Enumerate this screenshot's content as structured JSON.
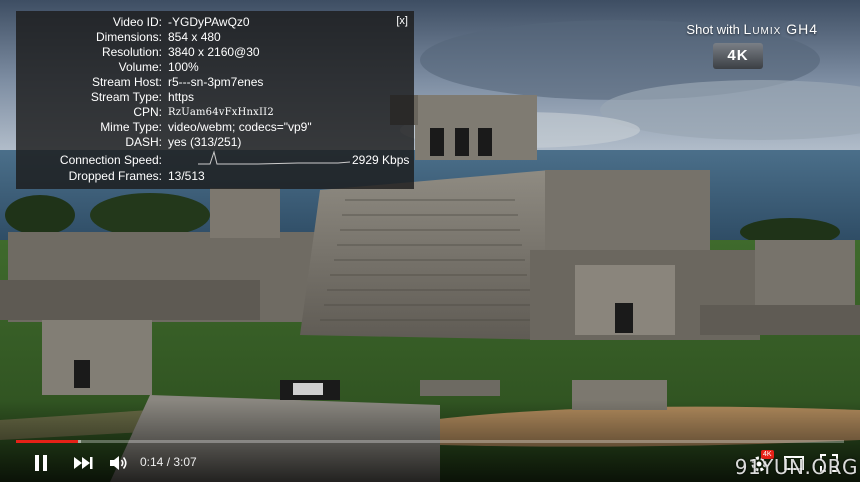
{
  "stats": {
    "close_label": "[x]",
    "rows": [
      {
        "key": "Video ID:",
        "value": "-YGDyPAwQz0"
      },
      {
        "key": "Dimensions:",
        "value": "854 x 480"
      },
      {
        "key": "Resolution:",
        "value": "3840 x 2160@30"
      },
      {
        "key": "Volume:",
        "value": "100%"
      },
      {
        "key": "Stream Host:",
        "value": "r5---sn-3pm7enes"
      },
      {
        "key": "Stream Type:",
        "value": "https"
      },
      {
        "key": "CPN:",
        "value": "RzUam64vFxHnxII2"
      },
      {
        "key": "Mime Type:",
        "value": "video/webm; codecs=\"vp9\""
      },
      {
        "key": "DASH:",
        "value": "yes (313/251)"
      },
      {
        "key": "Connection Speed:",
        "value": "2929 Kbps"
      },
      {
        "key": "Dropped Frames:",
        "value": "13/513"
      }
    ]
  },
  "branding": {
    "shot_with": "Shot with",
    "model": "Lumix GH4",
    "badge": "4K"
  },
  "controls": {
    "current_time": "0:14",
    "separator": " / ",
    "duration": "3:07",
    "played_fraction": 0.075,
    "loaded_fraction": 0.078,
    "hd_badge": "4K",
    "icons": [
      "pause-icon",
      "next-icon",
      "volume-icon",
      "settings-icon",
      "theater-icon",
      "fullscreen-icon"
    ]
  },
  "watermark": "91YUN.ORG",
  "colors": {
    "progress_played": "#e62117",
    "overlay_bg": "#1c1c1c"
  }
}
